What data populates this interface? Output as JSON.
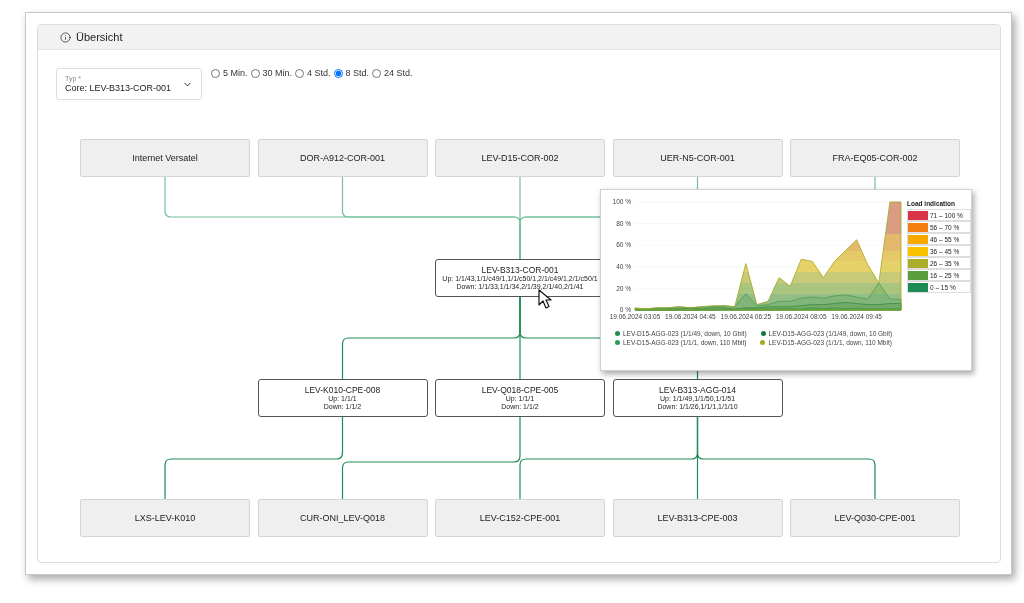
{
  "panel": {
    "title": "Übersicht"
  },
  "type_select": {
    "label": "Typ *",
    "value": "Core: LEV-B313-COR-001"
  },
  "time_ranges": [
    {
      "label": "5 Min.",
      "selected": false
    },
    {
      "label": "30 Min.",
      "selected": false
    },
    {
      "label": "4 Std.",
      "selected": false
    },
    {
      "label": "8 Std.",
      "selected": true
    },
    {
      "label": "24 Std.",
      "selected": false
    }
  ],
  "diagram": {
    "upstream": [
      {
        "name": "Internet Versatel"
      },
      {
        "name": "DOR-A912-COR-001"
      },
      {
        "name": "LEV-D15-COR-002"
      },
      {
        "name": "UER-N5-COR-001"
      },
      {
        "name": "FRA-EQ05-COR-002"
      }
    ],
    "core": {
      "name": "LEV-B313-COR-001",
      "up": "Up: 1/1/43,1/1/c49/1,1/1/c50/1,2/1/c49/1,2/1/c50/1",
      "down": "Down: 1/1/33,1/1/34,2/1/39,2/1/40,2/1/41"
    },
    "downstream": [
      {
        "name": "LEV-K010-CPE-008",
        "up": "Up: 1/1/1",
        "down": "Down: 1/1/2",
        "children": [
          {
            "name": "LXS-LEV-K010"
          }
        ]
      },
      {
        "name": "LEV-Q018-CPE-005",
        "up": "Up: 1/1/1",
        "down": "Down: 1/1/2",
        "children": [
          {
            "name": "CUR-ONI_LEV-Q018"
          }
        ]
      },
      {
        "name": "LEV-B313-AGG-014",
        "up": "Up: 1/1/49,1/1/50,1/1/51",
        "down": "Down: 1/1/26,1/1/1,1/1/10",
        "children": [
          {
            "name": "LEV-C152-CPE-001"
          },
          {
            "name": "LEV-B313-CPE-003"
          },
          {
            "name": "LEV-Q030-CPE-001"
          }
        ]
      }
    ]
  },
  "chart_popup": {
    "chart_data": {
      "type": "area",
      "categories": [
        "19.06.2024 03:05",
        null,
        null,
        null,
        null,
        "19.06.2024 04:45",
        null,
        null,
        null,
        null,
        "19.06.2024 06:25",
        null,
        null,
        null,
        null,
        "19.06.2024 08:05",
        null,
        null,
        null,
        null,
        "19.06.2024 09:45",
        null,
        null,
        null,
        null
      ],
      "ylim": [
        0,
        100
      ],
      "grid": true,
      "yticks": [
        {
          "value": 0,
          "label": "0 %"
        },
        {
          "value": 20,
          "label": "20 %"
        },
        {
          "value": 40,
          "label": "40 %"
        },
        {
          "value": 60,
          "label": "60 %"
        },
        {
          "value": 80,
          "label": "80 %"
        },
        {
          "value": 100,
          "label": "100 %"
        }
      ],
      "series": [
        {
          "name": "LEV-D15-AGG-023 (1/1/49, down, 10 Gbit)",
          "color": "#1e8f4e",
          "values": [
            0,
            0,
            0,
            0,
            0,
            0,
            0,
            0,
            1,
            0,
            1,
            1,
            1,
            1,
            1,
            1,
            2,
            1,
            2,
            1,
            2,
            1,
            1,
            1,
            1
          ]
        },
        {
          "name": "LEV-D15-AGG-023 (1/1/49, down, 10 Gbit)",
          "color": "#117a40",
          "values": [
            0,
            1,
            1,
            1,
            1,
            2,
            1,
            2,
            2,
            1,
            2,
            2,
            3,
            3,
            3,
            4,
            5,
            5,
            6,
            7,
            6,
            5,
            5,
            6,
            6
          ]
        },
        {
          "name": "LEV-D15-AGG-023 (1/1/1, down, 110 Mbit)",
          "color": "#2e9c5e",
          "values": [
            1,
            1,
            2,
            2,
            3,
            2,
            3,
            3,
            4,
            3,
            15,
            4,
            5,
            8,
            8,
            11,
            12,
            11,
            13,
            14,
            12,
            10,
            25,
            10,
            10
          ]
        },
        {
          "name": "LEV-D15-AGG-023 (1/1/1, down, 110 Mbit)",
          "color": "#a5a820",
          "values": [
            2,
            1,
            2,
            2,
            3,
            2,
            3,
            4,
            4,
            3,
            43,
            5,
            8,
            30,
            22,
            47,
            45,
            30,
            45,
            55,
            65,
            42,
            25,
            100,
            100
          ]
        }
      ]
    },
    "load_legend": {
      "title": "Load indication",
      "items": [
        {
          "label": "71 – 100 %",
          "color": "#d9344a"
        },
        {
          "label": "56 – 70 %",
          "color": "#f47f10"
        },
        {
          "label": "46 – 55 %",
          "color": "#f9a800"
        },
        {
          "label": "36 – 45 %",
          "color": "#f8c200"
        },
        {
          "label": "26 – 35 %",
          "color": "#a9ad2a"
        },
        {
          "label": "16 – 25 %",
          "color": "#5a9f3e"
        },
        {
          "label": "0 – 15 %",
          "color": "#1e8a55"
        }
      ]
    }
  }
}
